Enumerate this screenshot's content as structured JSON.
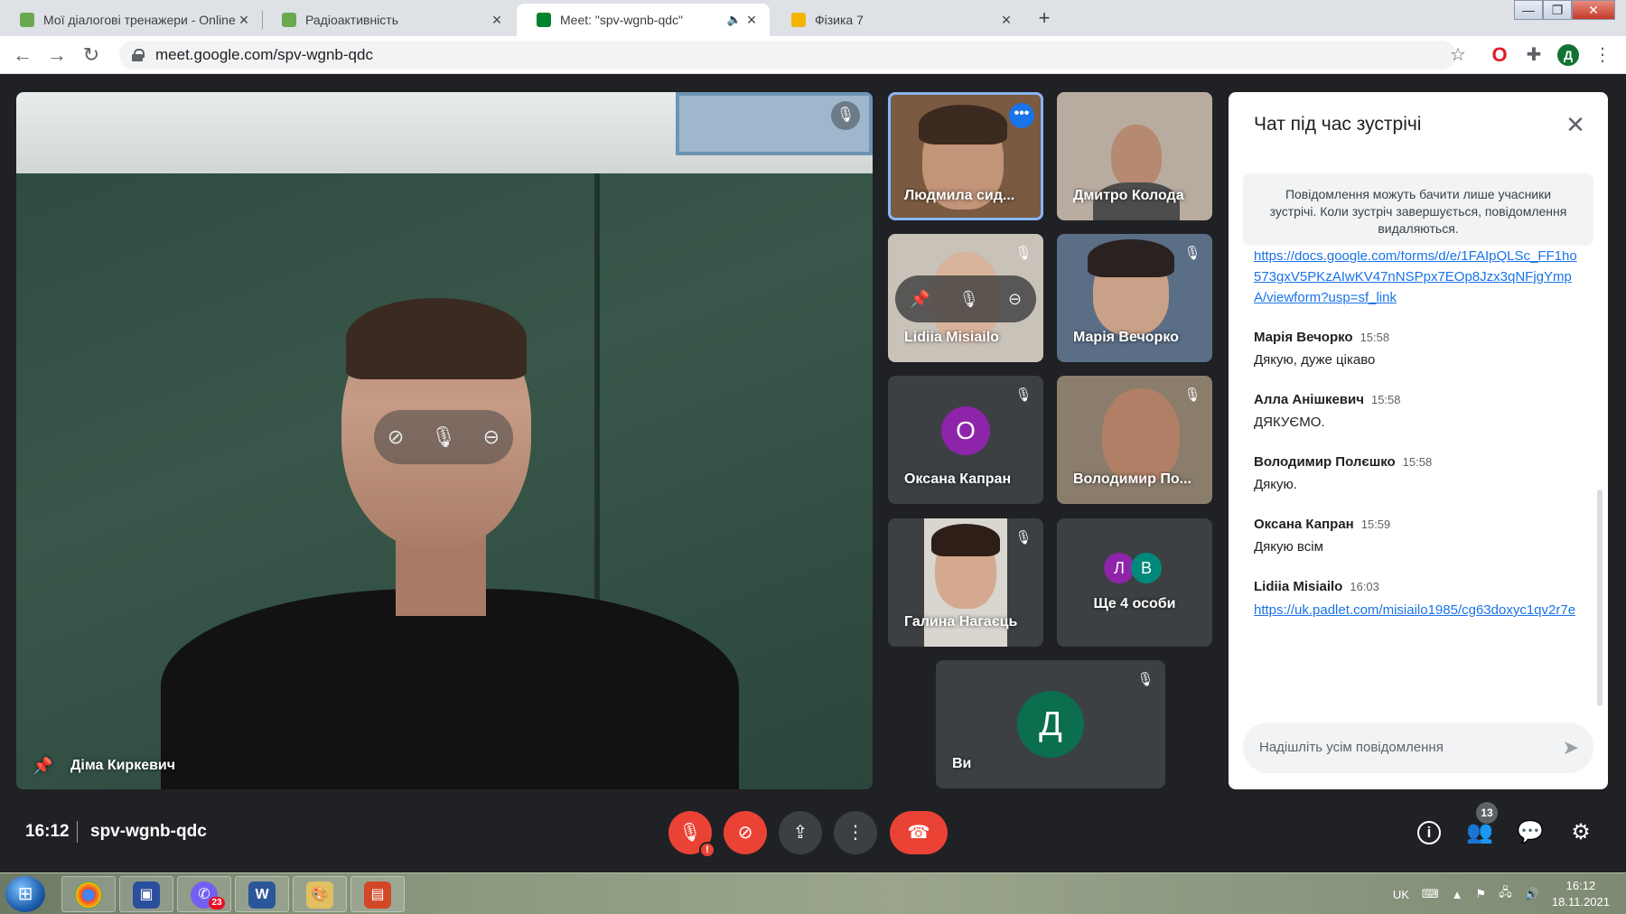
{
  "browser": {
    "tabs": [
      {
        "title": "Мої діалогові тренажери - Online",
        "favicon_color": "#6aa84f",
        "active": false
      },
      {
        "title": "Радіоактивність",
        "favicon_color": "#6aa84f",
        "active": false
      },
      {
        "title": "Meet: \"spv-wgnb-qdc\"",
        "favicon_color": "#00832d",
        "active": true
      },
      {
        "title": "Фізика 7",
        "favicon_color": "#f4b400",
        "active": false
      }
    ],
    "new_tab_icon": "+",
    "url": "meet.google.com/spv-wgnb-qdc",
    "profile_initial": "Д"
  },
  "meeting": {
    "time": "16:12",
    "code": "spv-wgnb-qdc",
    "main_speaker": "Діма Киркевич",
    "people_count": "13",
    "mic_alert": "!"
  },
  "tiles": [
    {
      "name": "Людмила сид...",
      "type": "video",
      "speaking": true
    },
    {
      "name": "Дмитро Колода",
      "type": "video"
    },
    {
      "name": "Lidiia Misiailo",
      "type": "video"
    },
    {
      "name": "Марія Вечорко",
      "type": "video"
    },
    {
      "name": "Оксана Капран",
      "type": "avatar",
      "initial": "О",
      "color": "#8e24aa"
    },
    {
      "name": "Володимир По...",
      "type": "video"
    },
    {
      "name": "Галина Нагаєць",
      "type": "video"
    },
    {
      "name": "Ще 4 особи",
      "type": "group",
      "initials": [
        "Л",
        "В"
      ],
      "colors": [
        "#8e24aa",
        "#00897b"
      ]
    },
    {
      "name": "Ви",
      "type": "avatar",
      "initial": "Д",
      "color": "#0b6e4f"
    }
  ],
  "chat": {
    "title": "Чат під час зустрічі",
    "notice": "Повідомлення можуть бачити лише учасники зустрічі. Коли зустріч завершується, повідомлення видаляються.",
    "partial_link": "https://docs.google.com/forms/d/e/1FAIpQLSc_FF1ho573gxV5PKzAIwKV47nNSPpx7EOp8Jzx3qNFjgYmpA/viewform?usp=sf_link",
    "messages": [
      {
        "sender": "Марія Вечорко",
        "time": "15:58",
        "text": "Дякую, дуже цікаво"
      },
      {
        "sender": "Алла Анішкевич",
        "time": "15:58",
        "text": "ДЯКУЄМО."
      },
      {
        "sender": "Володимир Полєшко",
        "time": "15:58",
        "text": "Дякую."
      },
      {
        "sender": "Оксана Капран",
        "time": "15:59",
        "text": "Дякую всім"
      },
      {
        "sender": "Lidiia Misiailo",
        "time": "16:03",
        "link": "https://uk.padlet.com/misiailo1985/cg63doxyc1qv2r7e"
      }
    ],
    "input_placeholder": "Надішліть усім повідомлення"
  },
  "taskbar": {
    "viber_badge": "23",
    "language": "UK",
    "clock_time": "16:12",
    "clock_date": "18.11.2021"
  },
  "icons": {
    "mic_off": "mic-off-icon",
    "camera_off": "camera-off-icon",
    "present": "present-icon",
    "more": "more-options-icon",
    "leave": "leave-call-icon",
    "info": "info-icon",
    "people": "people-icon",
    "chat": "chat-icon",
    "activities": "activities-icon"
  }
}
